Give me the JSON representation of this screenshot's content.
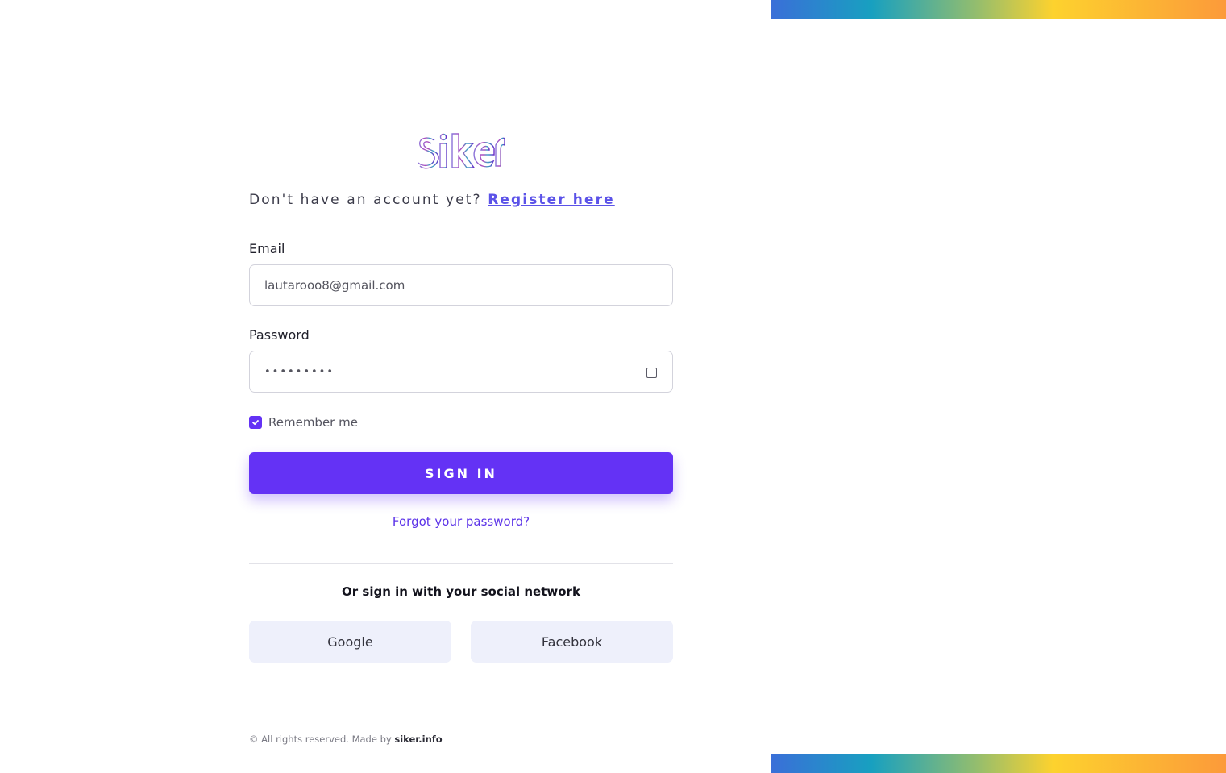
{
  "brand": {
    "logo_text": "siker"
  },
  "register": {
    "prompt": "Don't have an account yet?",
    "link_label": "Register here"
  },
  "form": {
    "email_label": "Email",
    "email_value": "lautarooo8@gmail.com",
    "password_label": "Password",
    "password_value": "•••••••••",
    "remember_label": "Remember me",
    "remember_checked": true,
    "submit_label": "SIGN IN",
    "forgot_label": "Forgot your password?"
  },
  "social": {
    "title": "Or sign in with your social network",
    "google_label": "Google",
    "facebook_label": "Facebook"
  },
  "footer": {
    "text": "© All rights reserved. Made by",
    "link_label": "siker.info"
  },
  "colors": {
    "accent": "#6432f5",
    "link": "#5b52e8",
    "social_bg": "#eef0fb",
    "gradient": [
      "#3a6fd8",
      "#18a0c0",
      "#93bd6e",
      "#fdd22e",
      "#fc9a3a"
    ]
  }
}
